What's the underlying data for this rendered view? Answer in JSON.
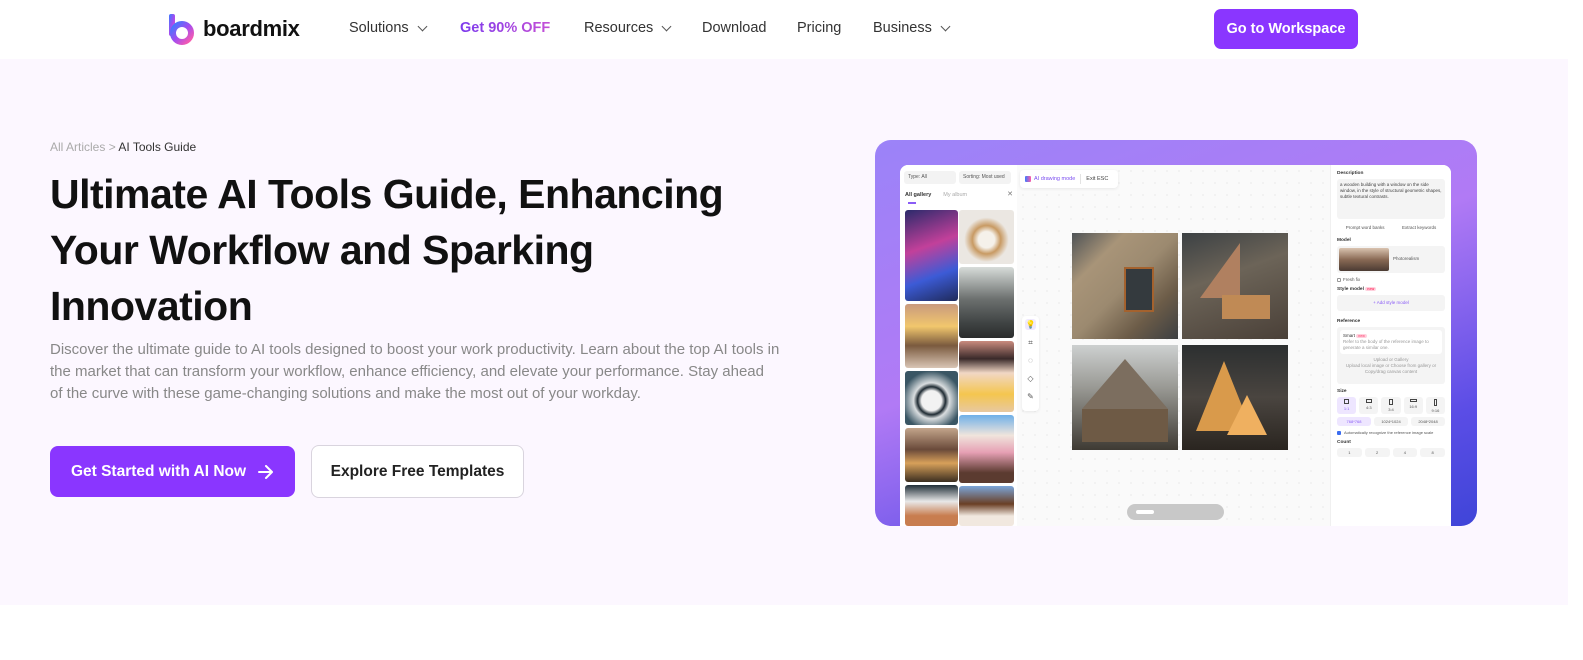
{
  "nav": {
    "brand": "boardmix",
    "items": [
      {
        "label": "Solutions",
        "has_dropdown": true
      },
      {
        "label": "Get 90% OFF",
        "has_dropdown": false,
        "promo": true
      },
      {
        "label": "Resources",
        "has_dropdown": true
      },
      {
        "label": "Download",
        "has_dropdown": false
      },
      {
        "label": "Pricing",
        "has_dropdown": false
      },
      {
        "label": "Business",
        "has_dropdown": true
      }
    ],
    "cta": "Go to Workspace"
  },
  "breadcrumb": {
    "parent": "All Articles",
    "separator": " > ",
    "current": "AI Tools Guide"
  },
  "hero": {
    "title": "Ultimate AI Tools Guide, Enhancing Your Workflow and Sparking Innovation",
    "description": "Discover the ultimate guide to AI tools designed to boost your work productivity. Learn about the top AI tools in the market that can transform your workflow, enhance efficiency, and elevate your performance. Stay ahead of the curve with these game-changing solutions and make the most out of your workday.",
    "primary_button": "Get Started with AI Now",
    "secondary_button": "Explore Free Templates"
  },
  "colors": {
    "accent": "#8a36ff",
    "hero_bg": "#fcf7ff"
  },
  "preview": {
    "filters": {
      "type": "Type: All",
      "sorting": "Sorting: Most used"
    },
    "tabs": {
      "gallery": "All gallery",
      "album": "My album"
    },
    "mode": {
      "label": "AI drawing mode",
      "exit": "Exit ESC"
    },
    "panel": {
      "description_label": "Description",
      "description_text": "a wooden building with a window on the side window, in the style of structural geometric shapes, subtle textural contrasts.",
      "prompt_word_banks": "Prompt word banks",
      "extract_keywords": "Extract keywords",
      "model_label": "Model",
      "model_value": "Photorealism",
      "fresh_fix": "Fresh fix",
      "style_model_label": "Style model",
      "new_badge": "new",
      "add_style_model": "+ Add style model",
      "reference_label": "Reference",
      "smart_label": "Smart",
      "smart_hint": "Refer to the body of the reference image to generate a similar one.",
      "upload_hint_title": "Upload or Gallery",
      "upload_hint": "Upload local image or Choose from gallery or Copy/drag canvas content",
      "size_label": "Size",
      "ratios": [
        "1:1",
        "4:3",
        "3:4",
        "16:9",
        "9:16"
      ],
      "resolutions": [
        "768*768",
        "1024*1024",
        "2048*2048"
      ],
      "auto_scale": "Automatically recognize the reference image scale",
      "count_label": "Count",
      "counts": [
        "1",
        "2",
        "4",
        "8"
      ]
    }
  }
}
